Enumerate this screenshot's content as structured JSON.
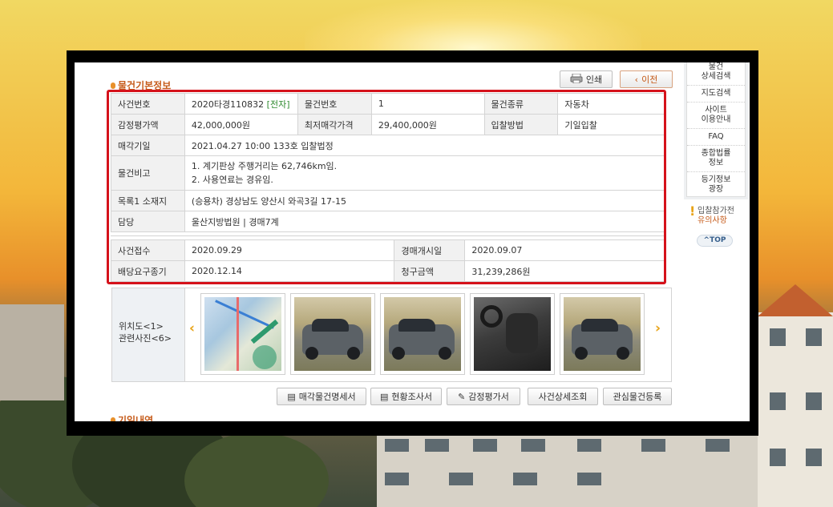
{
  "section_title": "물건기본정보",
  "buttons": {
    "print": "인쇄",
    "prev": "이전"
  },
  "table": {
    "case_number_label": "사건번호",
    "case_number": "2020타경110832",
    "case_tag": "[전자]",
    "item_number_label": "물건번호",
    "item_number": "1",
    "item_type_label": "물건종류",
    "item_type": "자동차",
    "appraisal_label": "감정평가액",
    "appraisal": "42,000,000원",
    "min_price_label": "최저매각가격",
    "min_price": "29,400,000원",
    "bid_method_label": "입찰방법",
    "bid_method": "기일입찰",
    "sale_date_label": "매각기일",
    "sale_date": "2021.04.27 10:00 133호 입찰법정",
    "remarks_label": "물건비고",
    "remarks_line1": "1. 계기판상 주행거리는 62,746km임.",
    "remarks_line2": "2. 사용연료는 경유임.",
    "location_label": "목록1 소재지",
    "location": "(승용차) 경상남도 양산시 와곡3길 17-15",
    "charge_label": "담당",
    "charge": "울산지방법원 | 경매7계"
  },
  "table2": {
    "receipt_label": "사건접수",
    "receipt": "2020.09.29",
    "auction_start_label": "경매개시일",
    "auction_start": "2020.09.07",
    "dividend_label": "배당요구종기",
    "dividend": "2020.12.14",
    "claim_label": "청구금액",
    "claim": "31,239,286원"
  },
  "photos": {
    "label_line1": "위치도<1>",
    "label_line2": "관련사진<6>"
  },
  "bottom_buttons": {
    "sale_spec": "매각물건명세서",
    "status_report": "현황조사서",
    "appraisal_report": "감정평가서",
    "case_detail": "사건상세조회",
    "watch": "관심물건등록"
  },
  "section2_title": "기일내역",
  "side_menu": {
    "item1_line1": "물건",
    "item1_line2": "상세검색",
    "item2": "지도검색",
    "item3_line1": "사이트",
    "item3_line2": "이용안내",
    "item4": "FAQ",
    "item5_line1": "종합법률",
    "item5_line2": "정보",
    "item6_line1": "등기정보",
    "item6_line2": "광장"
  },
  "notice": {
    "line1": "입찰참가전",
    "line2": "유의사항"
  },
  "top_button": "TOP"
}
